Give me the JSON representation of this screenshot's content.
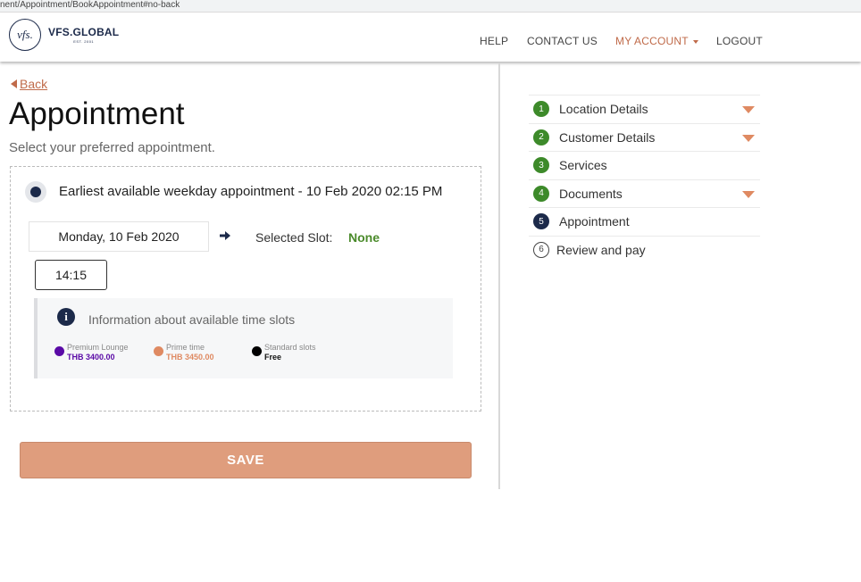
{
  "browser": {
    "url_fragment": "nent/Appointment/BookAppointment#no-back"
  },
  "header": {
    "logo_initials": "vfs.",
    "logo_name": "VFS.GLOBAL",
    "logo_est": "EST. 2001",
    "nav": {
      "help": "HELP",
      "contact": "CONTACT US",
      "my_account": "MY ACCOUNT",
      "logout": "LOGOUT"
    }
  },
  "main": {
    "back_label": "Back",
    "title": "Appointment",
    "subtitle": "Select your preferred appointment.",
    "earliest_label": "Earliest available weekday appointment - 10 Feb 2020 02:15 PM",
    "selected_date": "Monday, 10 Feb 2020",
    "selected_slot_label": "Selected Slot:",
    "selected_slot_value": "None",
    "time_slot": "14:15",
    "info": {
      "title": "Information about available time slots",
      "legend": [
        {
          "name": "Premium Lounge",
          "price": "THB 3400.00",
          "color": "#5a0aa6"
        },
        {
          "name": "Prime time",
          "price": "THB 3450.00",
          "color": "#df8a62"
        },
        {
          "name": "Standard slots",
          "price": "Free",
          "color": "#000000"
        }
      ]
    },
    "save_label": "SAVE"
  },
  "steps": [
    {
      "number": "1",
      "label": "Location Details",
      "state": "done",
      "expandable": true
    },
    {
      "number": "2",
      "label": "Customer Details",
      "state": "done",
      "expandable": true
    },
    {
      "number": "3",
      "label": "Services",
      "state": "done",
      "expandable": false
    },
    {
      "number": "4",
      "label": "Documents",
      "state": "done",
      "expandable": true
    },
    {
      "number": "5",
      "label": "Appointment",
      "state": "active",
      "expandable": false
    },
    {
      "number": "6",
      "label": "Review and pay",
      "state": "todo",
      "expandable": false
    }
  ],
  "colors": {
    "accent": "#c06b4a",
    "save_button": "#df9d7d",
    "step_done": "#3d8a2a",
    "step_active": "#1c2a4a",
    "slot_value": "#4a8a2a"
  }
}
